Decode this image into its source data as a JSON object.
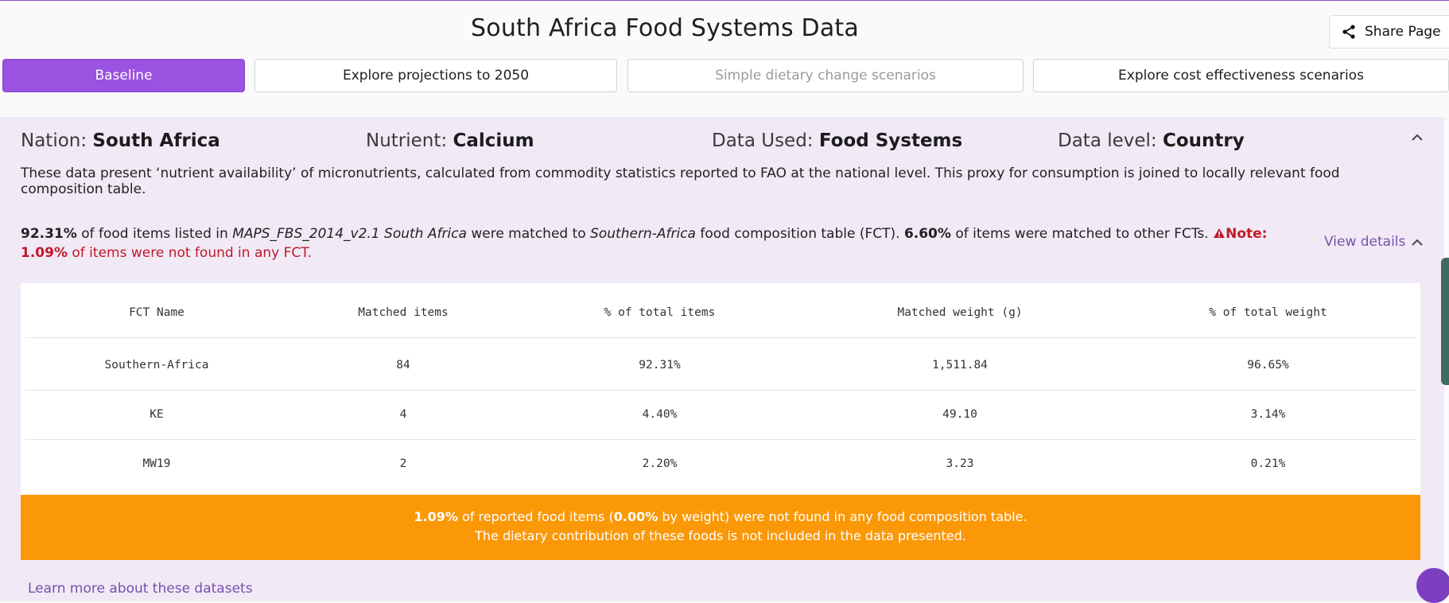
{
  "header": {
    "title": "South Africa Food Systems Data",
    "share_label": "Share Page",
    "share_icon": "share-icon"
  },
  "tabs": [
    {
      "label": "Baseline",
      "state": "active"
    },
    {
      "label": "Explore projections to 2050",
      "state": "normal"
    },
    {
      "label": "Simple dietary change scenarios",
      "state": "disabled"
    },
    {
      "label": "Explore cost effectiveness scenarios",
      "state": "normal"
    }
  ],
  "meta": {
    "nation_label": "Nation:",
    "nation_value": "South Africa",
    "nutrient_label": "Nutrient:",
    "nutrient_value": "Calcium",
    "data_used_label": "Data Used:",
    "data_used_value": "Food Systems",
    "data_level_label": "Data level:",
    "data_level_value": "Country",
    "description": "These data present ‘nutrient availability’ of micronutrients, calculated from commodity statistics reported to FAO at the national level. This proxy for consumption is joined to locally relevant food composition table."
  },
  "match": {
    "pct_matched": "92.31%",
    "text_1": " of food items listed in ",
    "dataset": "MAPS_FBS_2014_v2.1 South Africa",
    "text_2": " were matched to ",
    "fct": "Southern-Africa",
    "text_3": " food composition table (FCT). ",
    "pct_other": "6.60%",
    "text_4": " of items were matched to other FCTs. ",
    "note_label": "Note: ",
    "pct_not_found": "1.09%",
    "text_5": " of items were not found in any FCT.",
    "view_details": "View details"
  },
  "table": {
    "headers": [
      "FCT Name",
      "Matched items",
      "% of total items",
      "Matched weight (g)",
      "% of total weight"
    ],
    "rows": [
      [
        "Southern-Africa",
        "84",
        "92.31%",
        "1,511.84",
        "96.65%"
      ],
      [
        "KE",
        "4",
        "4.40%",
        "49.10",
        "3.14%"
      ],
      [
        "MW19",
        "2",
        "2.20%",
        "3.23",
        "0.21%"
      ]
    ]
  },
  "banner": {
    "pct_items": "1.09%",
    "text_1": " of reported food items (",
    "pct_weight": "0.00%",
    "text_2": " by weight) were not found in any food composition table.",
    "line_2": "The dietary contribution of these foods is not included in the data presented."
  },
  "footer": {
    "learn_more": "Learn more about these datasets"
  },
  "colors": {
    "accent": "#9a52e0",
    "panel": "#f1e9f5",
    "warning": "#c0182a",
    "banner": "#fb9808",
    "link": "#7a4fae"
  }
}
